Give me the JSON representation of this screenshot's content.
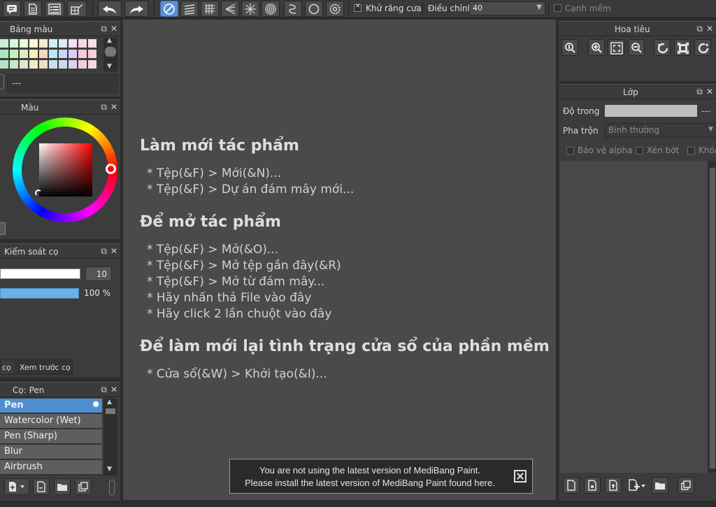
{
  "toolbar": {
    "antialias_label": "Khử răng cưa",
    "adjust_label": "Điều chỉnh",
    "adjust_value": "40",
    "soft_edge_label": "Cạnh mềm"
  },
  "colors": {
    "accent": "#5b8fd6",
    "panel_bg": "#3c3c3c",
    "canvas_bg": "#4a4a4a",
    "brush_selected": "#4f8fd0"
  },
  "palette_panel": {
    "title": "Bảng màu",
    "field_value": "---",
    "swatches": [
      "#c8f0d8",
      "#d8f8d8",
      "#e8f8d8",
      "#f8f8d0",
      "#f8e8d0",
      "#d0f0f8",
      "#e0e8f8",
      "#f0e0f8",
      "#f8d8e0",
      "#f8e0e8",
      "#a8e8c0",
      "#c0f0c0",
      "#d8f0c0",
      "#f8f0b8",
      "#f8d8b8",
      "#b8e8f8",
      "#c8d8f8",
      "#e0c8f8",
      "#f8c8d8",
      "#f8d0e0",
      "#b8e0c8",
      "#c8e8c8",
      "#e0e8c8",
      "#f0ecc8",
      "#f0dcc8",
      "#c8e0f0",
      "#d0d8f0",
      "#e0d0f0",
      "#f0d0dc",
      "#f0d8e4"
    ]
  },
  "color_panel": {
    "title": "Màu"
  },
  "brush_control_panel": {
    "title": "Kiểm soát cọ",
    "size_value": "10",
    "opacity_value": "100 %",
    "tab_brush": "cọ",
    "tab_preview": "Xem trước cọ"
  },
  "brush_panel": {
    "title": "Cọ: Pen",
    "items": [
      "Pen",
      "Watercolor (Wet)",
      "Pen (Sharp)",
      "Blur",
      "Airbrush"
    ]
  },
  "canvas": {
    "sections": [
      {
        "heading": "Làm mới tác phẩm",
        "lines": [
          "* Tệp(&F) > Mới(&N)...",
          "* Tệp(&F) > Dự án đám mây mới..."
        ]
      },
      {
        "heading": "Để mở tác phẩm",
        "lines": [
          "* Tệp(&F) > Mở(&O)...",
          "* Tệp(&F) > Mở tệp gần đây(&R)",
          "* Tệp(&F) > Mở từ đám mây...",
          "* Hãy nhấn thả File vào đây",
          "* Hãy click 2 lần chuột vào đây"
        ]
      },
      {
        "heading": "Để làm mới lại tình trạng cửa sổ của phần mềm",
        "lines": [
          "* Cửa sổ(&W) > Khởi tạo(&I)..."
        ]
      }
    ]
  },
  "notice": {
    "line1": "You are not using the latest version of MediBang Paint.",
    "line2": "Please install the latest version of MediBang Paint found here."
  },
  "navigator_panel": {
    "title": "Hoa tiêu"
  },
  "layer_panel": {
    "title": "Lớp",
    "opacity_label": "Độ trong",
    "opacity_value": "---",
    "blend_label": "Pha trộn",
    "blend_value": "Bình thường",
    "protect_alpha": "Bảo vệ alpha",
    "clipping": "Xén bớt",
    "lock": "Khóa"
  }
}
